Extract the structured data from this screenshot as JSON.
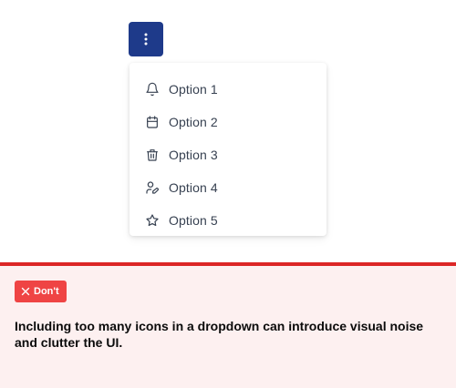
{
  "menu_button": {
    "icon": "more-vertical-icon",
    "color": "#1e3a8a"
  },
  "menu": {
    "items": [
      {
        "label": "Option 1",
        "icon": "bell-icon"
      },
      {
        "label": "Option 2",
        "icon": "calendar-icon"
      },
      {
        "label": "Option 3",
        "icon": "trash-icon"
      },
      {
        "label": "Option 4",
        "icon": "user-edit-icon"
      },
      {
        "label": "Option 5",
        "icon": "star-icon"
      }
    ]
  },
  "guidance": {
    "badge_label": "Don't",
    "badge_icon": "close-icon",
    "accent_color": "#dc2626",
    "text": "Including too many icons in a dropdown can introduce visual noise and clutter the UI."
  }
}
